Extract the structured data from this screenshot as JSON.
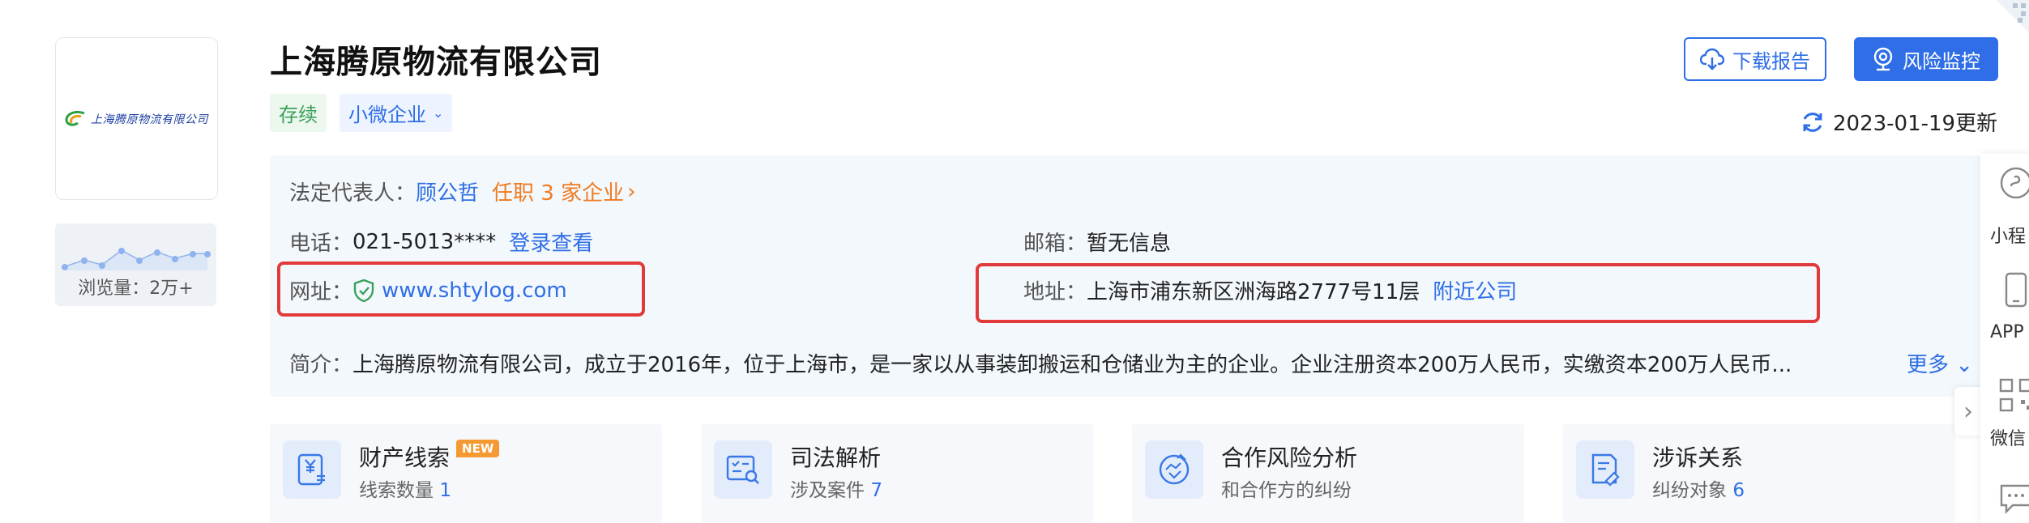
{
  "company": {
    "name": "上海腾原物流有限公司",
    "logo_text": "上海腾原物流有限公司",
    "status_tag": "存续",
    "scale_tag": "小微企业"
  },
  "views": {
    "label": "浏览量：2万+"
  },
  "actions": {
    "download": "下载报告",
    "monitor": "风险监控"
  },
  "update": {
    "text": "2023-01-19更新"
  },
  "info": {
    "legal_label": "法定代表人：",
    "legal_name": "顾公哲",
    "legal_jobs": "任职 3 家企业",
    "phone_label": "电话：",
    "phone_value": "021-5013****",
    "phone_link": "登录查看",
    "email_label": "邮箱：",
    "email_value": "暂无信息",
    "site_label": "网址：",
    "site_value": "www.shtylog.com",
    "addr_label": "地址：",
    "addr_value": "上海市浦东新区洲海路2777号11层",
    "addr_link": "附近公司",
    "intro_label": "简介：",
    "intro_value": "上海腾原物流有限公司，成立于2016年，位于上海市，是一家以从事装卸搬运和仓储业为主的企业。企业注册资本200万人民币，实缴资本200万人民币...",
    "intro_more": "更多"
  },
  "features": [
    {
      "title": "财产线索",
      "badge": "NEW",
      "sub_label": "线索数量 ",
      "sub_value": "1"
    },
    {
      "title": "司法解析",
      "badge": "",
      "sub_label": "涉及案件 ",
      "sub_value": "7"
    },
    {
      "title": "合作风险分析",
      "badge": "",
      "sub_label": "和合作方的纠纷",
      "sub_value": ""
    },
    {
      "title": "涉诉关系",
      "badge": "",
      "sub_label": "纠纷对象 ",
      "sub_value": "6"
    }
  ],
  "side_panel": {
    "items": [
      "小程",
      "APP",
      "微信"
    ]
  },
  "colors": {
    "accent": "#2f6ee6",
    "orange": "#f07a1f",
    "highlight": "#e23a3a",
    "status_green": "#3aa15a"
  }
}
